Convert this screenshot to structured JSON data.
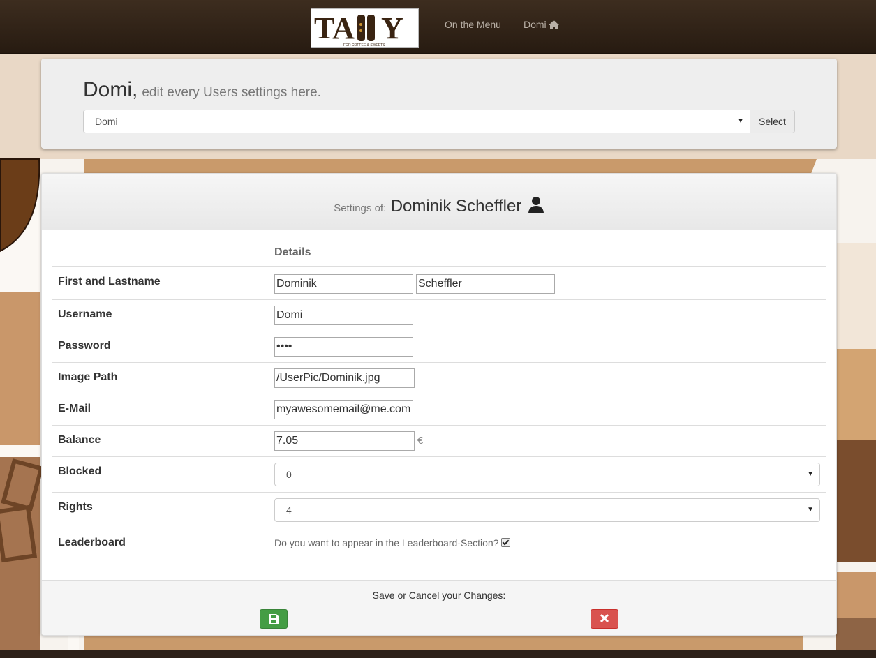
{
  "nav": {
    "logo_text": "TAllY",
    "logo_tagline": "FOR COFFEE & SWEETS",
    "menu_link": "On the Menu",
    "user_link": "Domi",
    "home_icon": "home-icon"
  },
  "header": {
    "name": "Domi,",
    "subtitle": "edit every Users settings here.",
    "selected_user": "Domi",
    "select_button": "Select"
  },
  "settings": {
    "heading_prefix": "Settings of:",
    "full_name": "Dominik Scheffler",
    "user_icon": "person-icon",
    "column_header": "Details",
    "rows": {
      "name": {
        "label": "First and Lastname",
        "first": "Dominik",
        "last": "Scheffler"
      },
      "username": {
        "label": "Username",
        "value": "Domi"
      },
      "password": {
        "label": "Password",
        "value": "••••"
      },
      "image_path": {
        "label": "Image Path",
        "value": "/UserPic/Dominik.jpg"
      },
      "email": {
        "label": "E-Mail",
        "value": "myawesomemail@me.com"
      },
      "balance": {
        "label": "Balance",
        "value": "7.05",
        "currency": "€"
      },
      "blocked": {
        "label": "Blocked",
        "value": "0"
      },
      "rights": {
        "label": "Rights",
        "value": "4"
      },
      "leaderboard": {
        "label": "Leaderboard",
        "question": "Do you want to appear in the Leaderboard-Section?",
        "checked": true
      }
    },
    "footer_text": "Save or Cancel your Changes:",
    "save_icon": "floppy-disk-icon",
    "cancel_icon": "close-icon"
  },
  "colors": {
    "navbar": "#2f2217",
    "save": "#449d44",
    "cancel": "#d9534f"
  }
}
